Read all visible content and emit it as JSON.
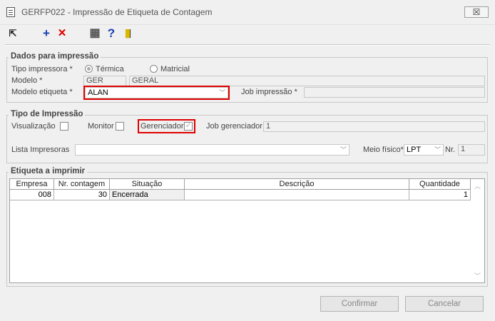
{
  "window": {
    "title": "GERFP022 - Impressão de Etiqueta de Contagem",
    "close": "☒"
  },
  "toolbar": {
    "items": [
      {
        "name": "exit-icon",
        "glyph": "⇱"
      },
      {
        "name": "add-icon",
        "glyph": "+"
      },
      {
        "name": "delete-icon",
        "glyph": "✕"
      },
      {
        "name": "calendar-icon",
        "glyph": "▦"
      },
      {
        "name": "help-icon",
        "glyph": "?"
      },
      {
        "name": "door-icon",
        "glyph": "▮"
      }
    ]
  },
  "dados": {
    "legend": "Dados para impressão",
    "tipo_label": "Tipo impressora *",
    "opt_termica": "Térmica",
    "opt_matricial": "Matricial",
    "modelo_label": "Modelo *",
    "modelo_code": "GER",
    "modelo_desc": "GERAL",
    "etiqueta_label": "Modelo etiqueta *",
    "etiqueta_value": "ALAN",
    "job_label": "Job impressão *",
    "job_value": ""
  },
  "tipo": {
    "legend": "Tipo de Impressão",
    "visualizacao": "Visualização",
    "monitor": "Monitor",
    "gerenciador": "Gerenciador",
    "job_gerenciador_label": "Job gerenciador",
    "job_gerenciador_value": "1",
    "lista_label": "Lista Impresoras",
    "lista_value": "",
    "meio_label": "Meio físico*",
    "meio_value": "LPT",
    "nr_label": "Nr.",
    "nr_value": "1"
  },
  "etiqueta": {
    "legend": "Etiqueta a imprimir",
    "columns": [
      "Empresa",
      "Nr. contagem",
      "Situação",
      "Descrição",
      "Quantidade"
    ],
    "rows": [
      {
        "empresa": "008",
        "nr_contagem": "30",
        "situacao": "Encerrada",
        "descricao": "",
        "quantidade": "1"
      }
    ]
  },
  "buttons": {
    "confirmar": "Confirmar",
    "cancelar": "Cancelar"
  }
}
